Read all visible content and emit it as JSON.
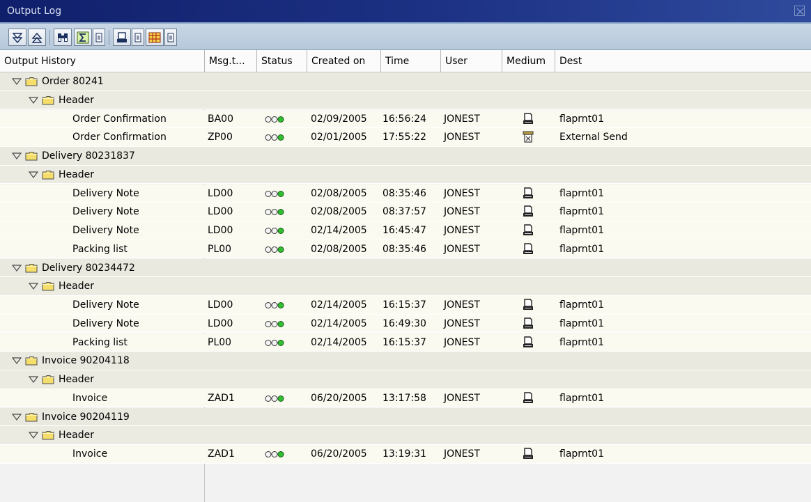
{
  "window": {
    "title": "Output Log"
  },
  "toolbar": {
    "buttons": [
      {
        "icon": "expand-all-icon"
      },
      {
        "icon": "collapse-all-icon"
      },
      {
        "icon": "find-icon"
      },
      {
        "icon": "sum-icon"
      },
      {
        "icon": "dropdown-icon"
      },
      {
        "icon": "print-icon"
      },
      {
        "icon": "dropdown-icon"
      },
      {
        "icon": "layout-icon"
      },
      {
        "icon": "dropdown-icon"
      }
    ]
  },
  "columns": {
    "output_history": "Output History",
    "msg_type": "Msg.t...",
    "status": "Status",
    "created_on": "Created on",
    "time": "Time",
    "user": "User",
    "medium": "Medium",
    "dest": "Dest"
  },
  "tree": [
    {
      "level": 0,
      "label": "Order 80241"
    },
    {
      "level": 1,
      "label": "Header"
    },
    {
      "level": 2,
      "label": "Order Confirmation",
      "msg": "BA00",
      "date": "02/09/2005",
      "time": "16:56:24",
      "user": "JONEST",
      "medium": "printer",
      "dest": "flaprnt01"
    },
    {
      "level": 2,
      "label": "Order Confirmation",
      "msg": "ZP00",
      "date": "02/01/2005",
      "time": "17:55:22",
      "user": "JONEST",
      "medium": "external",
      "dest": "External Send"
    },
    {
      "level": 0,
      "label": "Delivery 80231837"
    },
    {
      "level": 1,
      "label": "Header"
    },
    {
      "level": 2,
      "label": "Delivery Note",
      "msg": "LD00",
      "date": "02/08/2005",
      "time": "08:35:46",
      "user": "JONEST",
      "medium": "printer",
      "dest": "flaprnt01"
    },
    {
      "level": 2,
      "label": "Delivery Note",
      "msg": "LD00",
      "date": "02/08/2005",
      "time": "08:37:57",
      "user": "JONEST",
      "medium": "printer",
      "dest": "flaprnt01"
    },
    {
      "level": 2,
      "label": "Delivery Note",
      "msg": "LD00",
      "date": "02/14/2005",
      "time": "16:45:47",
      "user": "JONEST",
      "medium": "printer",
      "dest": "flaprnt01"
    },
    {
      "level": 2,
      "label": "Packing list",
      "msg": "PL00",
      "date": "02/08/2005",
      "time": "08:35:46",
      "user": "JONEST",
      "medium": "printer",
      "dest": "flaprnt01"
    },
    {
      "level": 0,
      "label": "Delivery 80234472"
    },
    {
      "level": 1,
      "label": "Header"
    },
    {
      "level": 2,
      "label": "Delivery Note",
      "msg": "LD00",
      "date": "02/14/2005",
      "time": "16:15:37",
      "user": "JONEST",
      "medium": "printer",
      "dest": "flaprnt01"
    },
    {
      "level": 2,
      "label": "Delivery Note",
      "msg": "LD00",
      "date": "02/14/2005",
      "time": "16:49:30",
      "user": "JONEST",
      "medium": "printer",
      "dest": "flaprnt01"
    },
    {
      "level": 2,
      "label": "Packing list",
      "msg": "PL00",
      "date": "02/14/2005",
      "time": "16:15:37",
      "user": "JONEST",
      "medium": "printer",
      "dest": "flaprnt01"
    },
    {
      "level": 0,
      "label": "Invoice 90204118"
    },
    {
      "level": 1,
      "label": "Header"
    },
    {
      "level": 2,
      "label": "Invoice",
      "msg": "ZAD1",
      "date": "06/20/2005",
      "time": "13:17:58",
      "user": "JONEST",
      "medium": "printer",
      "dest": "flaprnt01"
    },
    {
      "level": 0,
      "label": "Invoice 90204119"
    },
    {
      "level": 1,
      "label": "Header"
    },
    {
      "level": 2,
      "label": "Invoice",
      "msg": "ZAD1",
      "date": "06/20/2005",
      "time": "13:19:31",
      "user": "JONEST",
      "medium": "printer",
      "dest": "flaprnt01"
    }
  ],
  "colors": {
    "title_bar": "#1d3285",
    "toolbar": "#c1d1e2",
    "status_green": "#2fbf2f"
  }
}
